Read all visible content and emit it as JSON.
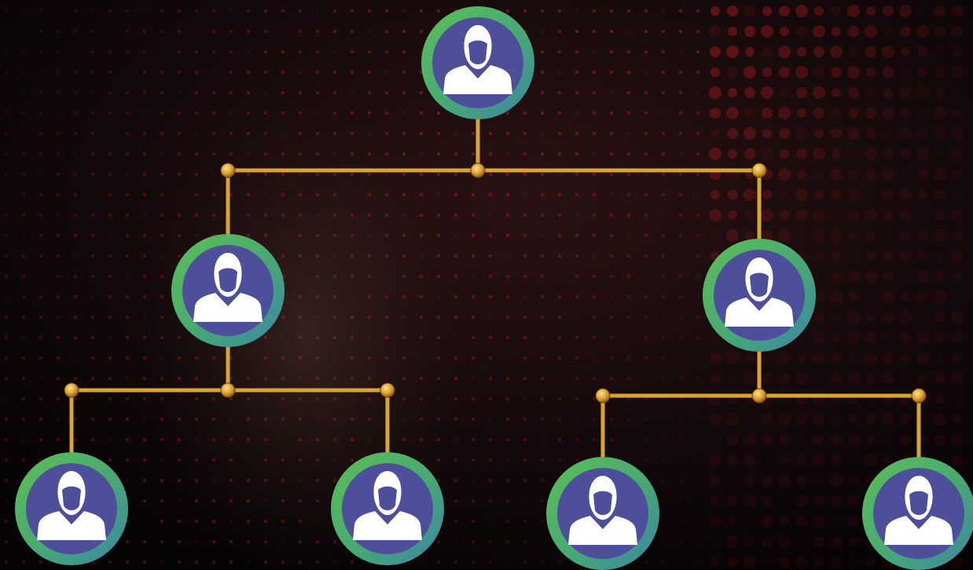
{
  "diagram": {
    "type": "org-chart",
    "node_icon": "person-avatar-icon",
    "colors": {
      "background": "#0b0708",
      "led_dots": "#c81c22",
      "connector": "#d9a530",
      "ring_green": "#4fb35a",
      "ring_teal": "#3a9aa0",
      "avatar_fill": "#4e4f9a",
      "silhouette": "#ffffff"
    },
    "levels": 3,
    "nodes": [
      {
        "id": "root",
        "level": 0
      },
      {
        "id": "left-manager",
        "level": 1,
        "parent": "root"
      },
      {
        "id": "right-manager",
        "level": 1,
        "parent": "root"
      },
      {
        "id": "left-report-1",
        "level": 2,
        "parent": "left-manager"
      },
      {
        "id": "left-report-2",
        "level": 2,
        "parent": "left-manager"
      },
      {
        "id": "right-report-1",
        "level": 2,
        "parent": "right-manager"
      },
      {
        "id": "right-report-2",
        "level": 2,
        "parent": "right-manager"
      }
    ]
  }
}
